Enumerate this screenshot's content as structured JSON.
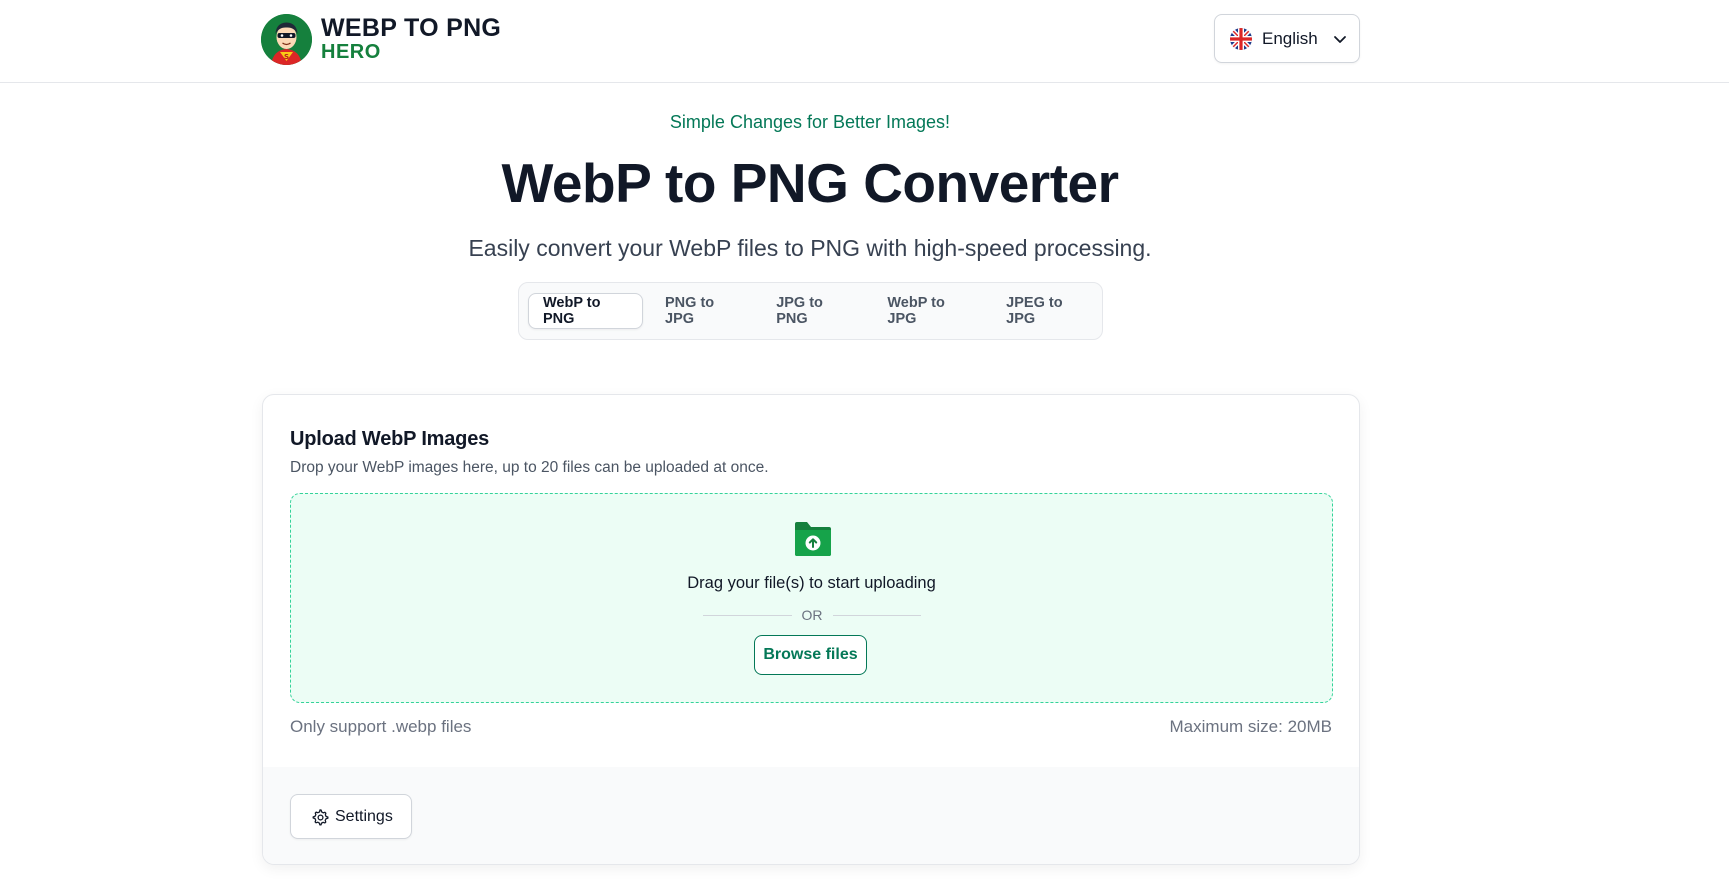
{
  "header": {
    "logo_line1": "WEBP TO PNG",
    "logo_line2": "HERO",
    "language": {
      "selected": "English",
      "icon": "uk-flag-icon"
    }
  },
  "hero": {
    "tagline": "Simple Changes for Better Images!",
    "title": "WebP to PNG Converter",
    "subtitle": "Easily convert your WebP files to PNG with high-speed processing."
  },
  "tabs": [
    {
      "label": "WebP to PNG",
      "active": true
    },
    {
      "label": "PNG to JPG",
      "active": false
    },
    {
      "label": "JPG to PNG",
      "active": false
    },
    {
      "label": "WebP to JPG",
      "active": false
    },
    {
      "label": "JPEG to JPG",
      "active": false
    }
  ],
  "upload": {
    "title": "Upload WebP Images",
    "description": "Drop your WebP images here, up to 20 files can be uploaded at once.",
    "drop_text": "Drag your file(s) to start uploading",
    "or_text": "OR",
    "browse_label": "Browse files",
    "support_text": "Only support .webp files",
    "max_size": "Maximum size: 20MB"
  },
  "settings": {
    "label": "Settings",
    "icon": "gear-icon"
  },
  "colors": {
    "brand_green": "#047857",
    "dropzone_bg": "#ecfdf5",
    "dropzone_border": "#34d399"
  }
}
